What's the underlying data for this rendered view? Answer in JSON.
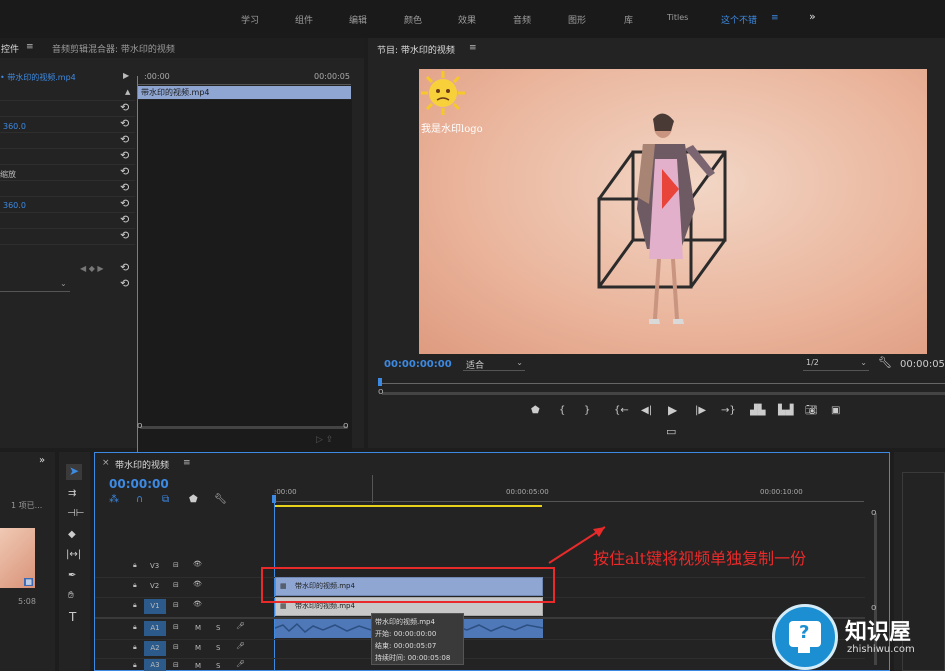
{
  "workspace": {
    "items": [
      "学习",
      "组件",
      "编辑",
      "颜色",
      "效果",
      "音频",
      "图形",
      "库",
      "Titles",
      "这个不错"
    ],
    "active": "这个不错",
    "more": "»"
  },
  "effect_controls": {
    "tab_label": "控件",
    "tab_menu": "≡",
    "mixer_tab": "音频剪辑混合器: 带水印的视频",
    "clip_name": "• 带水印的视频.mp4",
    "time_start": ":00:00",
    "time_end": "00:00:05",
    "timeline_clip": "带水印的视频.mp4",
    "row_values": [
      "360.0",
      "缩放",
      "360.0"
    ]
  },
  "program": {
    "title": "节目: 带水印的视频",
    "menu": "≡",
    "watermark_text": "我是水印logo",
    "timecode": "00:00:00:00",
    "fit": "适合",
    "resolution": "1/2",
    "end_timecode": "00:00:05"
  },
  "project": {
    "more": "»",
    "items_label": "1 项已...",
    "duration": "5:08"
  },
  "timeline": {
    "title": "带水印的视频",
    "menu": "≡",
    "close": "×",
    "timecode": "00:00:00",
    "ruler": [
      ":00:00",
      "00:00:05:00",
      "00:00:10:00"
    ],
    "tracks": [
      {
        "name": "V3"
      },
      {
        "name": "V2"
      },
      {
        "name": "V1"
      },
      {
        "name": "A1"
      },
      {
        "name": "A2"
      },
      {
        "name": "A3"
      }
    ],
    "clip_v2": "带水印的视频.mp4",
    "clip_v1": "带水印的视频.mp4",
    "tooltip": {
      "name": "带水印的视频.mp4",
      "start": "开始: 00:00:00:00",
      "end": "结束: 00:00:05:07",
      "duration": "持续时间: 00:00:05:08"
    }
  },
  "annotation": {
    "text": "按住alt键将视频单独复制一份"
  },
  "brand": {
    "name": "知识屋",
    "url": "zhishiwu.com"
  },
  "colors": {
    "accent": "#3d8ae3",
    "annotation": "#e82a2a",
    "clip_blue": "#8fa6d3",
    "clip_gray": "#c8c8c8"
  }
}
